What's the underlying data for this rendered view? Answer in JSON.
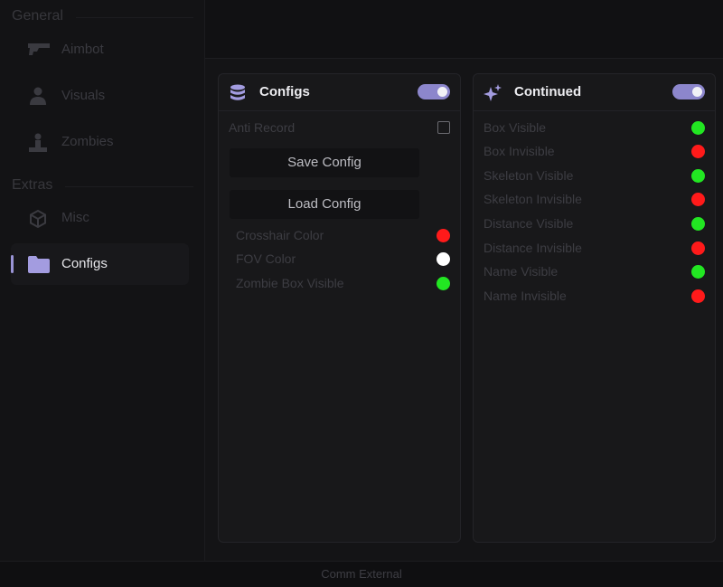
{
  "sidebar": {
    "sections": [
      {
        "title": "General"
      },
      {
        "title": "Extras"
      }
    ],
    "items": [
      {
        "label": "Aimbot",
        "icon": "gun-icon"
      },
      {
        "label": "Visuals",
        "icon": "person-icon"
      },
      {
        "label": "Zombies",
        "icon": "zombie-icon"
      },
      {
        "label": "Misc",
        "icon": "cube-icon"
      },
      {
        "label": "Configs",
        "icon": "folder-icon",
        "active": true
      }
    ]
  },
  "panels": {
    "configs": {
      "title": "Configs",
      "icon": "database-icon",
      "enabled": true,
      "anti_record_label": "Anti Record",
      "save_label": "Save Config",
      "load_label": "Load Config",
      "colors": [
        {
          "label": "Crosshair Color",
          "color": "#ff1a1a"
        },
        {
          "label": "FOV Color",
          "color": "#ffffff"
        },
        {
          "label": "Zombie Box Visible",
          "color": "#22e622"
        }
      ]
    },
    "continued": {
      "title": "Continued",
      "icon": "sparkle-icon",
      "enabled": true,
      "colors": [
        {
          "label": "Box Visible",
          "color": "#22e622"
        },
        {
          "label": "Box Invisible",
          "color": "#ff1a1a"
        },
        {
          "label": "Skeleton Visible",
          "color": "#22e622"
        },
        {
          "label": "Skeleton Invisible",
          "color": "#ff1a1a"
        },
        {
          "label": "Distance Visible",
          "color": "#22e622"
        },
        {
          "label": "Distance Invisible",
          "color": "#ff1a1a"
        },
        {
          "label": "Name Visible",
          "color": "#22e622"
        },
        {
          "label": "Name Invisible",
          "color": "#ff1a1a"
        }
      ]
    }
  },
  "footer": {
    "text": "Comm External"
  },
  "theme": {
    "accent": "#8c86cc"
  }
}
